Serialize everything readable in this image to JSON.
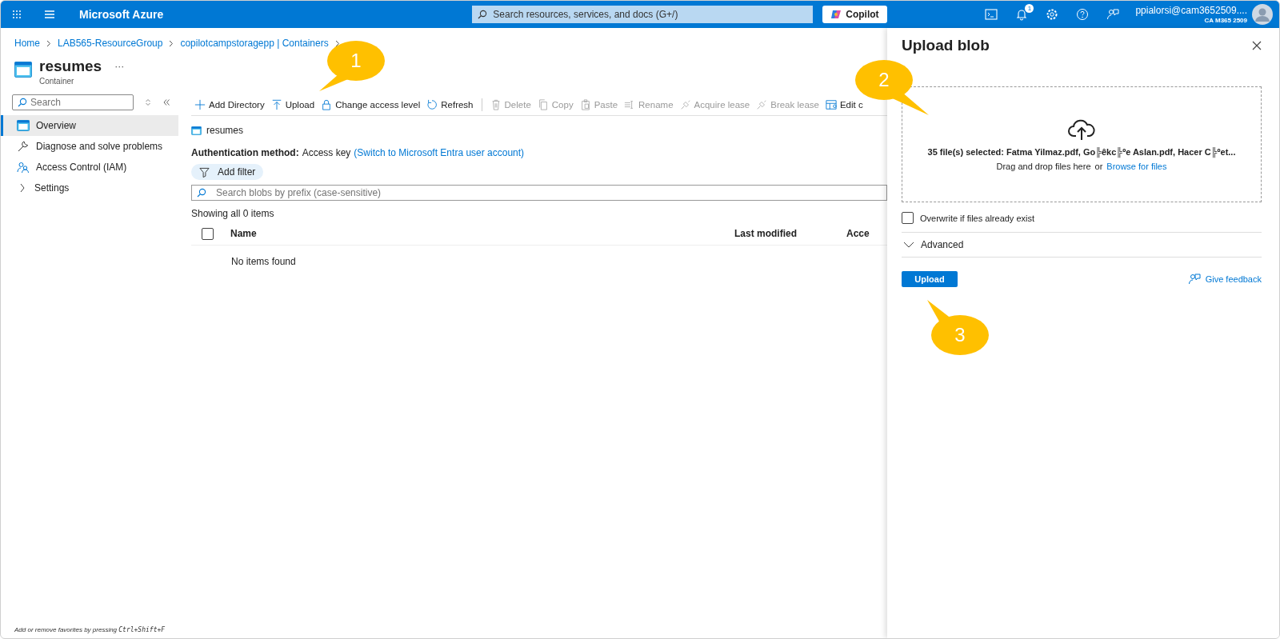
{
  "topbar": {
    "brand": "Microsoft Azure",
    "search": {
      "placeholder": "Search resources, services, and docs (G+/)"
    },
    "copilot": "Copilot",
    "notifications": "1",
    "user": {
      "name": "ppialorsi@cam3652509....",
      "tenant": "CA M365 2509"
    }
  },
  "breadcrumb": [
    "Home",
    "LAB565-ResourceGroup",
    "copilotcampstoragepp | Containers"
  ],
  "page": {
    "title": "resumes",
    "subtitle": "Container",
    "more": "···"
  },
  "sidebar": {
    "search": {
      "placeholder": "Search"
    },
    "items": [
      {
        "label": "Overview",
        "selected": true,
        "kind": "page"
      },
      {
        "label": "Diagnose and solve problems",
        "selected": false,
        "kind": "page"
      },
      {
        "label": "Access Control (IAM)",
        "selected": false,
        "kind": "page"
      },
      {
        "label": "Settings",
        "selected": false,
        "kind": "group",
        "expanded": false
      }
    ]
  },
  "toolbar": [
    {
      "label": "Add Directory",
      "disabled": false
    },
    {
      "label": "Upload",
      "disabled": false
    },
    {
      "label": "Change access level",
      "disabled": false
    },
    {
      "label": "Refresh",
      "disabled": false
    },
    {
      "label": "Delete",
      "disabled": true
    },
    {
      "label": "Copy",
      "disabled": true
    },
    {
      "label": "Paste",
      "disabled": true
    },
    {
      "label": "Rename",
      "disabled": true
    },
    {
      "label": "Acquire lease",
      "disabled": true
    },
    {
      "label": "Break lease",
      "disabled": true
    },
    {
      "label": "Edit c",
      "disabled": false
    }
  ],
  "location": "resumes",
  "auth": {
    "label": "Authentication method:",
    "value": "Access key",
    "link": "(Switch to Microsoft Entra user account)"
  },
  "filter_button": "Add filter",
  "blob_search": {
    "placeholder": "Search blobs by prefix (case-sensitive)"
  },
  "count": "Showing all 0 items",
  "table": {
    "select_all": {
      "checked": false
    },
    "columns": [
      "Name",
      "Last modified",
      "Acce"
    ],
    "empty": "No items found"
  },
  "footer": {
    "text": "Add or remove favorites by pressing",
    "shortcut": "Ctrl+Shift+F"
  },
  "panel": {
    "title": "Upload blob",
    "selected_files": "35 file(s) selected: Fatma Yilmaz.pdf, Go╠êkc╠ºe Aslan.pdf, Hacer C╠ºet...",
    "drop_hint": "Drag and drop files here",
    "or": "or",
    "browse": "Browse for files",
    "overwrite": {
      "label": "Overwrite if files already exist",
      "checked": false
    },
    "advanced": {
      "label": "Advanced",
      "expanded": false
    },
    "upload": "Upload",
    "feedback": "Give feedback"
  },
  "callouts": [
    "1",
    "2",
    "3"
  ]
}
